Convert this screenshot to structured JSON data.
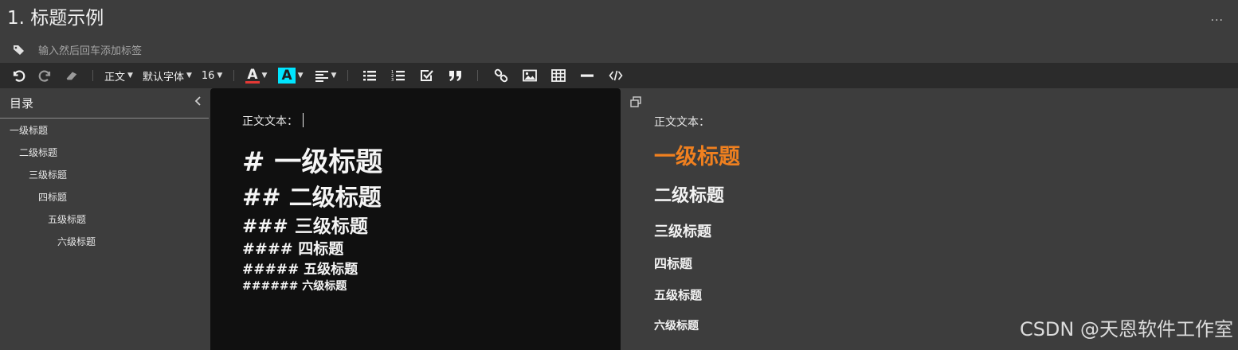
{
  "header": {
    "title": "1. 标题示例",
    "more_label": "..."
  },
  "tags": {
    "placeholder": "输入然后回车添加标签"
  },
  "toolbar": {
    "paragraph_label": "正文",
    "font_label": "默认字体",
    "size_label": "16",
    "text_color_glyph": "A",
    "highlight_glyph": "A",
    "text_color": "#e53935",
    "highlight_color": "#00e5ff"
  },
  "toc": {
    "title": "目录",
    "items": [
      {
        "label": "一级标题"
      },
      {
        "label": "二级标题"
      },
      {
        "label": "三级标题"
      },
      {
        "label": "四标题"
      },
      {
        "label": "五级标题"
      },
      {
        "label": "六级标题"
      }
    ]
  },
  "editor": {
    "body": "正文文本：",
    "lines": [
      "# 一级标题",
      "## 二级标题",
      "### 三级标题",
      "#### 四标题",
      "##### 五级标题",
      "###### 六级标题"
    ]
  },
  "preview": {
    "body": "正文文本：",
    "headings": [
      "一级标题",
      "二级标题",
      "三级标题",
      "四标题",
      "五级标题",
      "六级标题"
    ],
    "h1_color": "#f0801f"
  },
  "watermark": "CSDN @天恩软件工作室"
}
